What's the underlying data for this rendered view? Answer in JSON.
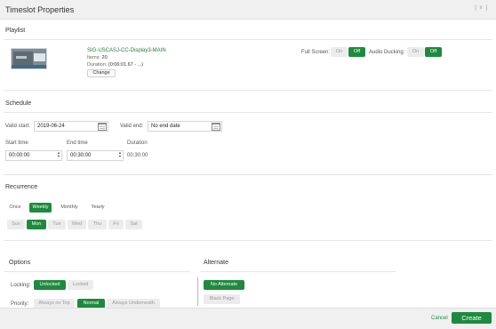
{
  "window": {
    "title": "Timeslot Properties",
    "close_label": "[ x ]"
  },
  "playlist": {
    "heading": "Playlist",
    "name": "SIG-USCASJ-CC-Display3-MAIN",
    "items_label": "Items:",
    "items_value": "20",
    "duration_label": "Duration:",
    "duration_value": "(0:06:01.67 - ...)",
    "change_label": "Change",
    "fullscreen_label": "Full Screen:",
    "fullscreen_options": [
      "On",
      "Off"
    ],
    "fullscreen_selected": "Off",
    "ducking_label": "Audio Ducking:",
    "ducking_options": [
      "On",
      "Off"
    ],
    "ducking_selected": "Off"
  },
  "schedule": {
    "heading": "Schedule",
    "valid_start_label": "Valid start:",
    "valid_start_value": "2019-06-24",
    "valid_end_label": "Valid end:",
    "valid_end_value": "No end date",
    "start_time_label": "Start time",
    "start_time_value": "00:00:00",
    "end_time_label": "End time",
    "end_time_value": "00:30:00",
    "duration_label": "Duration",
    "duration_value": "00:30:00"
  },
  "recurrence": {
    "heading": "Recurrence",
    "frequencies": [
      "Once",
      "Weekly",
      "Monthly",
      "Yearly"
    ],
    "frequency_selected": "Weekly",
    "days": [
      "Sun",
      "Mon",
      "Tue",
      "Wed",
      "Thu",
      "Fri",
      "Sat"
    ],
    "day_selected": "Mon"
  },
  "options": {
    "heading": "Options",
    "locking_label": "Locking:",
    "locking_options": [
      "Unlocked",
      "Locked"
    ],
    "locking_selected": "Unlocked",
    "priority_label": "Priority:",
    "priority_options": [
      "Always on Top",
      "Normal",
      "Always Underneath"
    ],
    "priority_selected": "Normal"
  },
  "alternate": {
    "heading": "Alternate",
    "options": [
      "No Alternate",
      "Black Page"
    ],
    "selected": "No Alternate"
  },
  "footer": {
    "cancel_label": "Cancel",
    "create_label": "Create"
  },
  "colors": {
    "accent": "#1e8a3e",
    "inactive": "#ececec",
    "header_bg": "#f0f0f0"
  }
}
